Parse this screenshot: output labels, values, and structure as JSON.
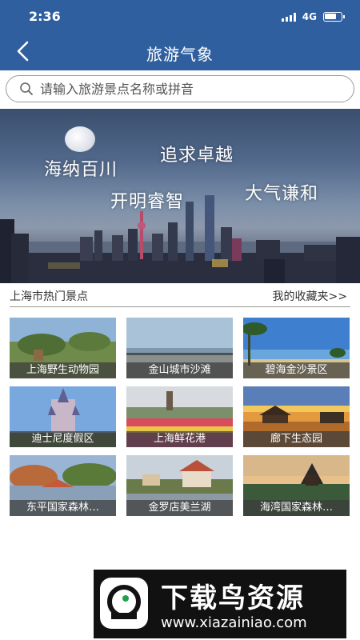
{
  "status": {
    "time": "2:36",
    "network": "4G"
  },
  "nav": {
    "title": "旅游气象"
  },
  "search": {
    "placeholder": "请输入旅游景点名称或拼音"
  },
  "banner": {
    "slogans": [
      "海纳百川",
      "追求卓越",
      "开明睿智",
      "大气谦和"
    ]
  },
  "section": {
    "title": "上海市热门景点",
    "more_label": "我的收藏夹>>"
  },
  "spots": [
    {
      "name": "上海野生动物园"
    },
    {
      "name": "金山城市沙滩"
    },
    {
      "name": "碧海金沙景区"
    },
    {
      "name": "迪士尼度假区"
    },
    {
      "name": "上海鲜花港"
    },
    {
      "name": "廊下生态园"
    },
    {
      "name": "东平国家森林…"
    },
    {
      "name": "金罗店美兰湖"
    },
    {
      "name": "海湾国家森林…"
    }
  ],
  "watermark": {
    "brand": "下载鸟资源",
    "url": "www.xiazainiao.com"
  },
  "colors": {
    "nav_bg": "#2f5f9e",
    "caption_bg": "#3c3c3c"
  }
}
